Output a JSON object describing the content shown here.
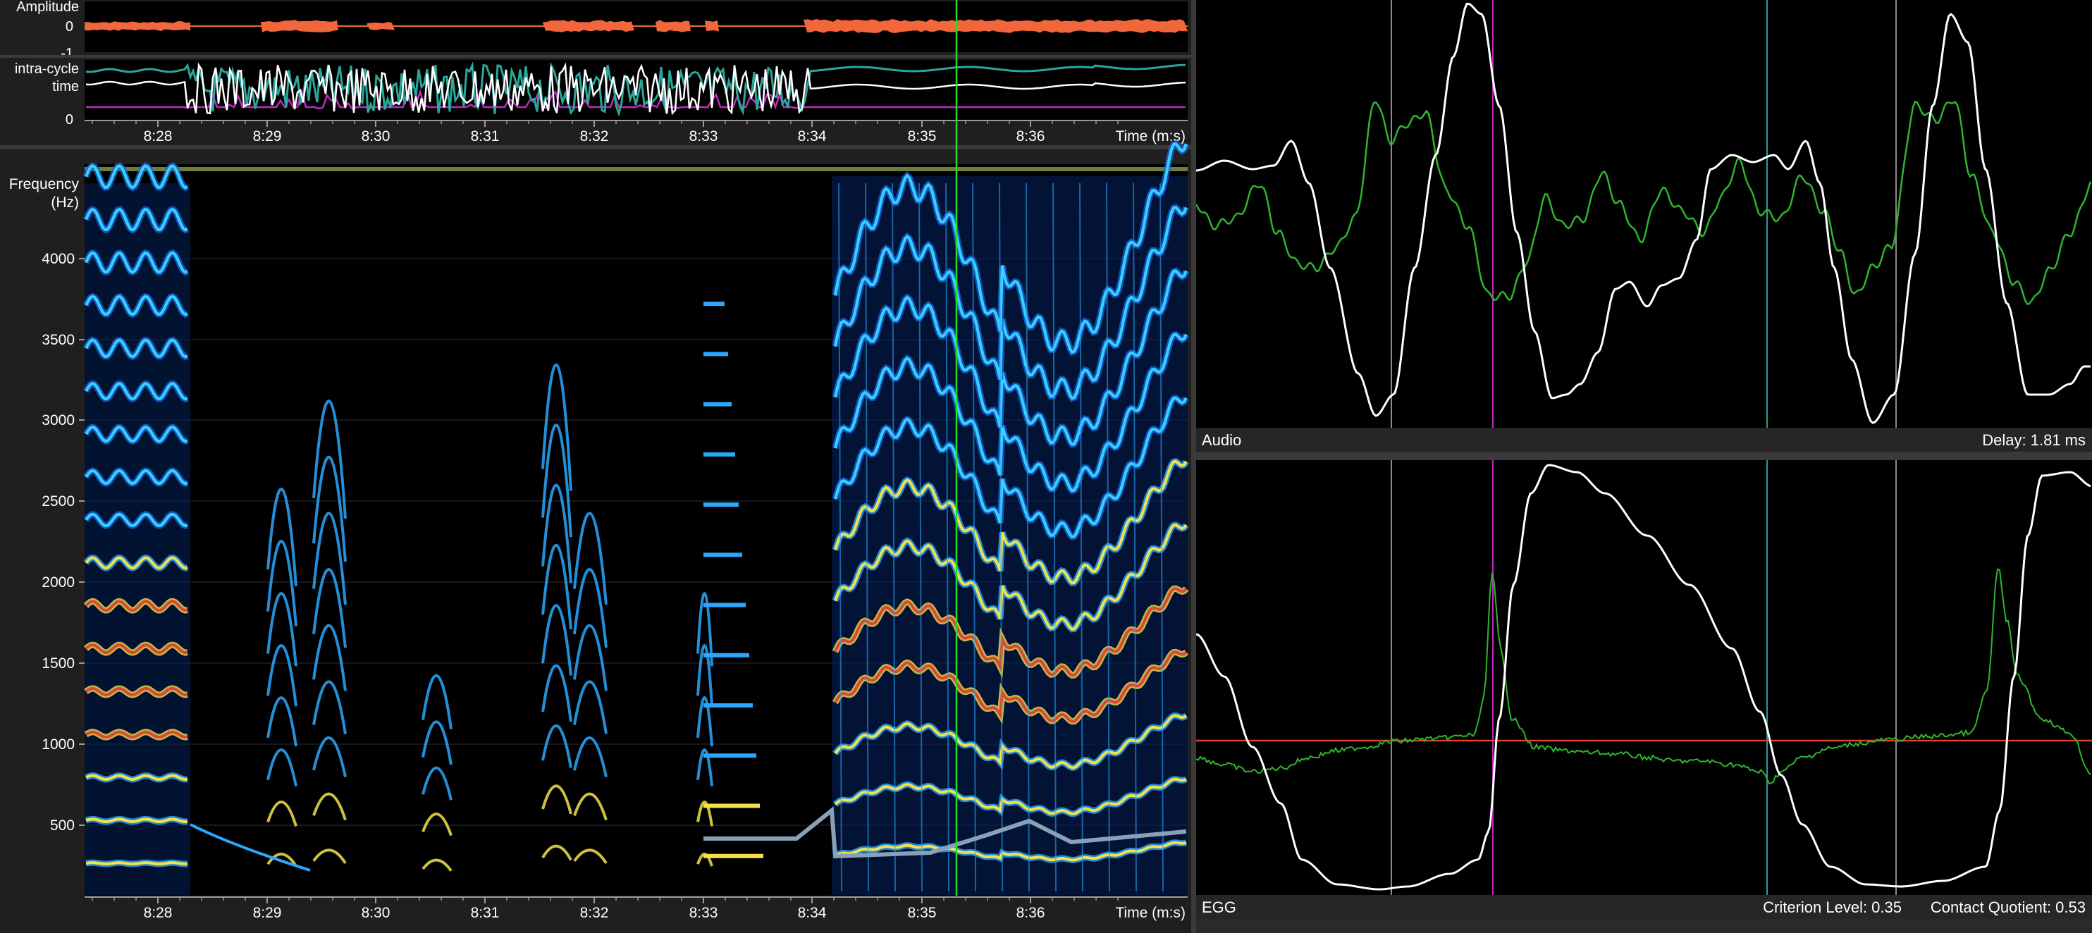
{
  "amplitude_panel": {
    "label": "Amplitude",
    "ticks": [
      "0",
      "-1"
    ]
  },
  "intracycle_panel": {
    "label_line1": "intra-cycle",
    "label_line2": "time",
    "ticks": [
      "0"
    ]
  },
  "time_axis": {
    "ticks": [
      "8:28",
      "8:29",
      "8:30",
      "8:31",
      "8:32",
      "8:33",
      "8:34",
      "8:35",
      "8:36"
    ],
    "unit_label": "Time (m:s)"
  },
  "spectrogram": {
    "ylabel_line1": "Frequency",
    "ylabel_line2": "(Hz)",
    "freq_ticks": [
      "4000",
      "3500",
      "3000",
      "2500",
      "2000",
      "1500",
      "1000",
      "500"
    ]
  },
  "audio_panel": {
    "label": "Audio",
    "delay": "Delay: 1.81 ms"
  },
  "egg_panel": {
    "label": "EGG",
    "criterion": "Criterion Level: 0.35",
    "contact_quotient": "Contact Quotient: 0.53"
  },
  "colors": {
    "amplitude": "#f2663c",
    "cursor": "#22dd22",
    "trace_white": "#ffffff",
    "trace_green": "#2fb52f",
    "trace_teal": "#2aa79a",
    "marker_magenta": "#c02ac0",
    "marker_gray": "#8c8c8c",
    "marker_teal": "#2a9a9a",
    "criterion_line": "#e0402a"
  }
}
